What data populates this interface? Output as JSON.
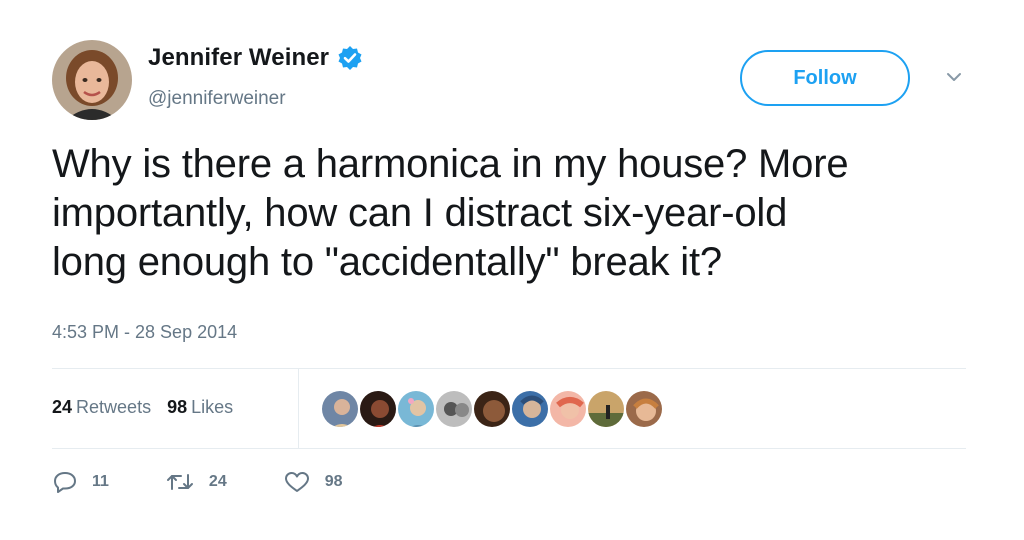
{
  "author": {
    "name": "Jennifer Weiner",
    "handle": "@jenniferweiner",
    "verified": true,
    "avatar_icon": "profile-photo"
  },
  "header": {
    "follow_label": "Follow",
    "more_icon": "chevron-down-icon"
  },
  "tweet": {
    "text": "Why is there a harmonica in my house? More\nimportantly, how can I distract six-year-old\nlong enough to \"accidentally\" break it?",
    "timestamp": "4:53 PM - 28 Sep 2014"
  },
  "stats": {
    "retweets_count": "24",
    "retweets_label": "Retweets",
    "likes_count": "98",
    "likes_label": "Likes"
  },
  "likers_count": 9,
  "actions": {
    "reply_count": "11",
    "retweet_count": "24",
    "like_count": "98"
  },
  "colors": {
    "brand_blue": "#1da1f2",
    "secondary_text": "#657786",
    "primary_text": "#14171a"
  }
}
